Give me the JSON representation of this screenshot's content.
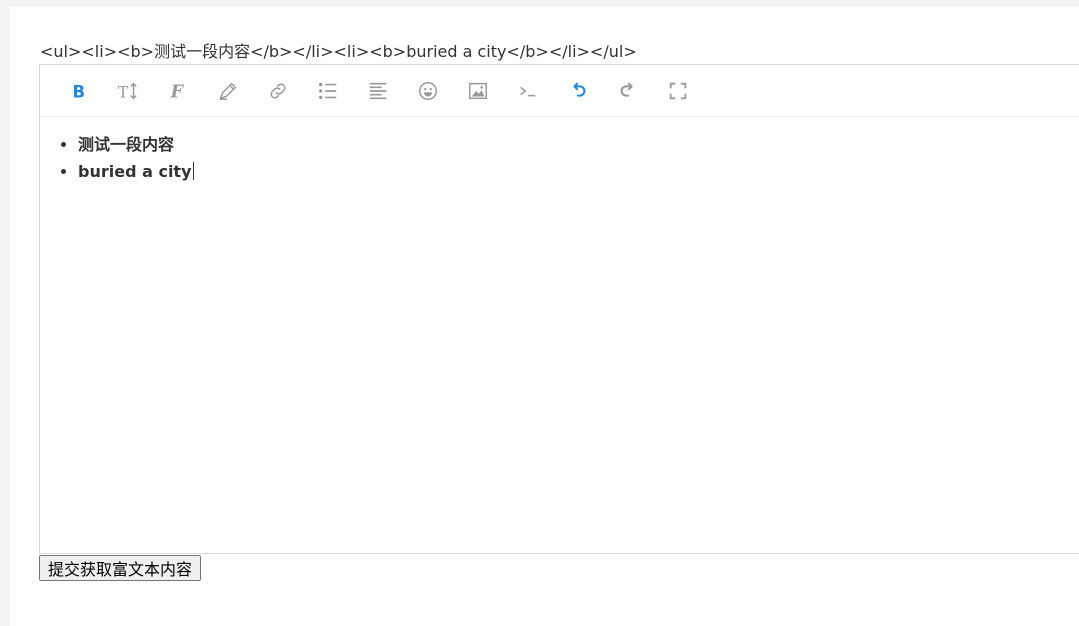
{
  "output_html": "<ul><li><b>测试一段内容</b></li><li><b>buried a city</b></li></ul>",
  "toolbar": {
    "buttons": [
      {
        "name": "bold",
        "icon": "bold-icon",
        "active": true
      },
      {
        "name": "font-size",
        "icon": "text-height-icon"
      },
      {
        "name": "font-family",
        "icon": "font-family-icon"
      },
      {
        "name": "color",
        "icon": "pencil-icon"
      },
      {
        "name": "link",
        "icon": "link-icon"
      },
      {
        "name": "list",
        "icon": "list-icon"
      },
      {
        "name": "align",
        "icon": "align-left-icon"
      },
      {
        "name": "emoji",
        "icon": "smile-icon"
      },
      {
        "name": "image",
        "icon": "image-icon"
      },
      {
        "name": "code",
        "icon": "terminal-icon"
      },
      {
        "name": "undo",
        "icon": "undo-icon"
      },
      {
        "name": "redo",
        "icon": "redo-icon"
      },
      {
        "name": "fullscreen",
        "icon": "fullscreen-icon"
      }
    ]
  },
  "content": {
    "items": [
      "测试一段内容",
      "buried a city"
    ]
  },
  "submit": {
    "label": "提交获取富文本内容"
  },
  "colors": {
    "accent": "#1e88e5",
    "icon": "#999999"
  }
}
